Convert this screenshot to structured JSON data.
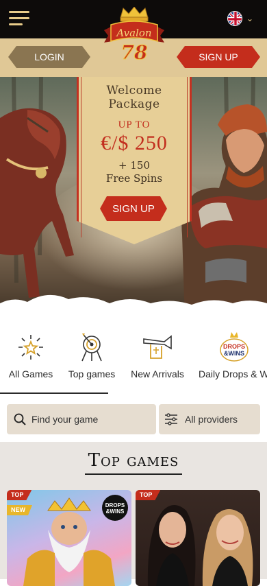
{
  "header": {
    "logo_text": "Avalon",
    "logo_number": "78",
    "menu_icon": "hamburger-icon",
    "language_flag": "uk-flag-icon"
  },
  "auth": {
    "login_label": "LOGIN",
    "signup_label": "SIGN UP"
  },
  "promo": {
    "title_line1": "Welcome",
    "title_line2": "Package",
    "upto": "UP TO",
    "amount": "€/$ 250",
    "spins_line1": "+ 150",
    "spins_line2": "Free Spins",
    "cta_label": "SIGN UP"
  },
  "categories": [
    {
      "label": "All Games",
      "icon": "stars-burst-icon"
    },
    {
      "label": "Top games",
      "icon": "target-easel-icon"
    },
    {
      "label": "New Arrivals",
      "icon": "trumpet-banner-icon"
    },
    {
      "label": "Daily Drops & Wins",
      "icon": "drops-wins-icon"
    }
  ],
  "search": {
    "placeholder": "Find your game",
    "providers_label": "All providers"
  },
  "top_games": {
    "title": "Top games",
    "cards": [
      {
        "badges": [
          "TOP",
          "NEW"
        ],
        "corner_badge_line1": "DROPS",
        "corner_badge_line2": "&WINS"
      },
      {
        "badges": [
          "TOP"
        ]
      }
    ]
  },
  "colors": {
    "brand_red": "#c42d1c",
    "gold": "#e0c896",
    "dark": "#0d0b0a"
  }
}
